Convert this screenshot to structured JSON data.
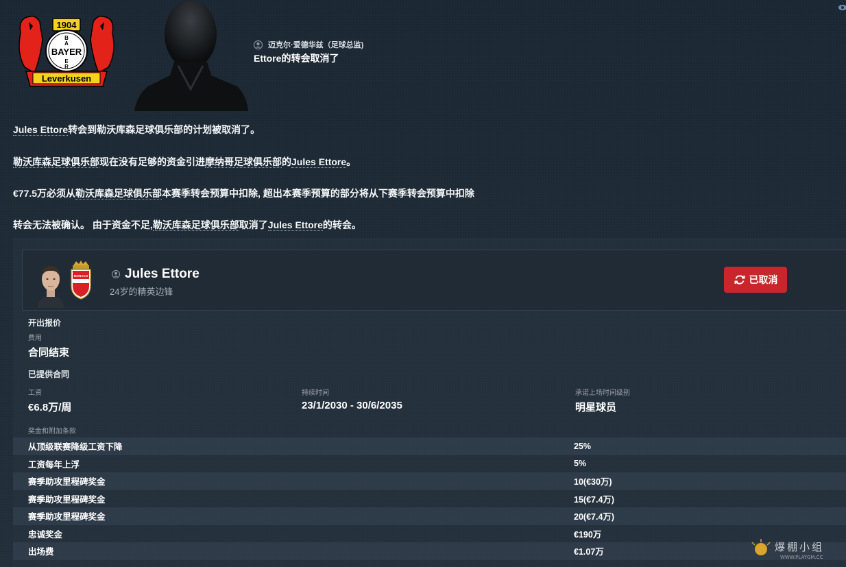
{
  "club": {
    "crest_year": "1904",
    "crest_word": "BAYER",
    "crest_banner": "Leverkusen",
    "colors": {
      "red": "#e32219",
      "black": "#000000",
      "gold": "#f5d21c"
    }
  },
  "message": {
    "sender": "迈克尔·爱德华兹（足球总监)",
    "subject": "Ettore的转会取消了",
    "paragraphs": {
      "p1_name": "Jules Ettore",
      "p1_text": "转会到勒沃库森足球俱乐部的计划被取消了。",
      "p2_club": "勒沃库森足球俱乐部",
      "p2_mid": "现在没有足够的资金引进",
      "p2_club2": "摩纳哥足球俱乐部",
      "p2_of": "的",
      "p2_name": "Jules Ettore",
      "p2_end": "。",
      "p3_amount": "€77.5万",
      "p3_a": "必须从",
      "p3_club": "勒沃库森足球俱乐部",
      "p3_b": "本赛季转会预算中扣除, 超出本赛季预算的部分将从下赛季转会预算中扣除",
      "p4_a": "转会无法被确认。 由于资金不足,",
      "p4_club": "勒沃库森足球俱乐部",
      "p4_b": "取消了",
      "p4_name": "Jules Ettore",
      "p4_c": "的转会。"
    }
  },
  "player": {
    "name": "Jules Ettore",
    "description": "24岁的精英边锋",
    "status_button": "已取消",
    "club_crest_text": "MONACO",
    "status_color": "#c8262c"
  },
  "offer": {
    "title": "开出报价",
    "fee_label": "费用",
    "fee_value": "合同结束",
    "contract_title": "已提供合同",
    "wage_label": "工资",
    "wage_value": "€6.8万/周",
    "duration_label": "持续时间",
    "duration_value": "23/1/2030 - 30/6/2035",
    "playing_time_label": "承诺上场时间级别",
    "playing_time_value": "明星球员",
    "bonus_title": "奖金和附加条款",
    "bonuses": [
      {
        "label": "从顶级联赛降级工资下降",
        "value": "25%"
      },
      {
        "label": "工资每年上浮",
        "value": "5%"
      },
      {
        "label": "赛季助攻里程碑奖金",
        "value": "10(€30万)"
      },
      {
        "label": "赛季助攻里程碑奖金",
        "value": "15(€7.4万)"
      },
      {
        "label": "赛季助攻里程碑奖金",
        "value": "20(€7.4万)"
      },
      {
        "label": "忠诚奖金",
        "value": "€190万"
      },
      {
        "label": "出场费",
        "value": "€1.07万"
      }
    ]
  },
  "watermark": {
    "text": "爆棚小组",
    "url": "WWW.PLAYGM.CC"
  }
}
